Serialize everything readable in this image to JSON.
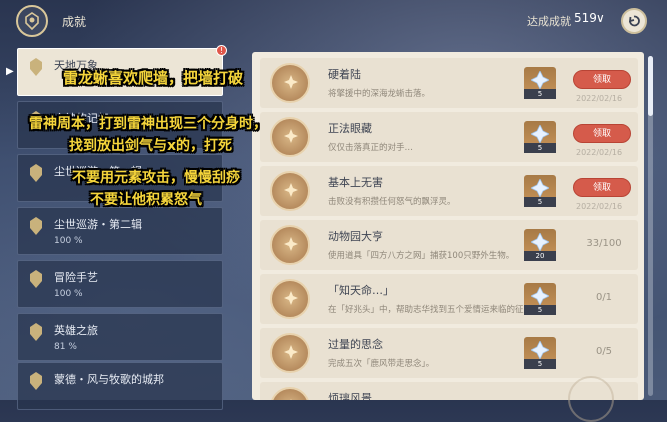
{
  "header": {
    "title": "成就",
    "total_label": "达成成就",
    "total_value": "519",
    "total_chevron": "∨"
  },
  "categories": [
    {
      "name": "天地万象",
      "pct": "",
      "active": true,
      "new_badge": "!"
    },
    {
      "name": "众神的记忆",
      "pct": ""
    },
    {
      "name": "尘世巡游・第一辑",
      "pct": ""
    },
    {
      "name": "尘世巡游・第二辑",
      "pct": "100 %"
    },
    {
      "name": "冒险手艺",
      "pct": "100 %"
    },
    {
      "name": "英雄之旅",
      "pct": "81 %"
    },
    {
      "name": "蒙德・风与牧歌的城邦",
      "pct": ""
    }
  ],
  "achievements": [
    {
      "title": "硬着陆",
      "desc": "将擎援中的深海龙蜥击落。",
      "reward_qty": "5",
      "claim_label": "领取",
      "date": "2022/02/16"
    },
    {
      "title": "正法眼藏",
      "desc": "仅仅击落真正的对手…",
      "reward_qty": "5",
      "claim_label": "领取",
      "date": "2022/02/16"
    },
    {
      "title": "基本上无害",
      "desc": "击败没有积攒任何怒气的飘浮灵。",
      "reward_qty": "5",
      "claim_label": "领取",
      "date": "2022/02/16"
    },
    {
      "title": "动物园大亨",
      "desc": "使用道具「四方八方之网」捕获100只野外生物。",
      "reward_qty": "20",
      "progress": "33/100"
    },
    {
      "title": "「知天命…」",
      "desc": "在「好兆头」中，帮助志华找到五个爱情运来临的征兆。",
      "reward_qty": "5",
      "progress": "0/1"
    },
    {
      "title": "过量的思念",
      "desc": "完成五次「鹿风带走思念」。",
      "reward_qty": "5",
      "progress": "0/5"
    },
    {
      "title": "烦璃风景",
      "desc": "",
      "reward_qty": "",
      "progress": ""
    }
  ],
  "overlay_notes": [
    "雷龙蜥喜欢爬墙，把墙打破",
    "雷神周本，打到雷神出现三个分身时，",
    "找到放出剑气与x的，打死",
    "不要用元素攻击，慢慢刮痧",
    "不要让他积累怒气"
  ],
  "colors": {
    "claim_button": "#d55b4b",
    "panel_bg": "#f1ebdf",
    "note_text": "#f5d53b"
  },
  "icons": {
    "emblem": "achievement-emblem-icon",
    "back": "back-arrow-icon",
    "reward": "primogem-icon"
  }
}
